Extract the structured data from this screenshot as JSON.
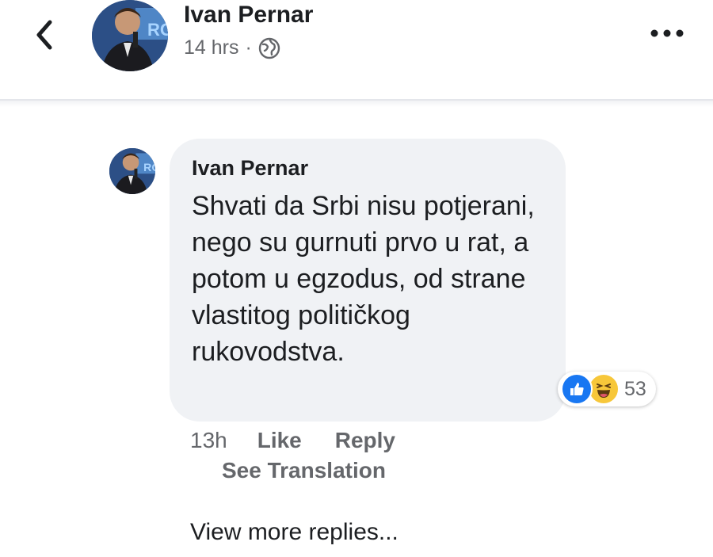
{
  "header": {
    "name": "Ivan Pernar",
    "time": "14 hrs",
    "separator": "·",
    "privacy_icon": "globe-icon",
    "back_icon": "chevron-left-icon",
    "more_icon": "more-dots-icon"
  },
  "comment": {
    "author": "Ivan Pernar",
    "text": "Shvati da Srbi nisu potjerani, nego su gurnuti prvo u rat, a potom u egzodus, od strane vlastitog političkog rukovodstva.",
    "reactions": {
      "icons": [
        "like-icon",
        "haha-icon"
      ],
      "count": "53"
    },
    "time": "13h",
    "like_label": "Like",
    "reply_label": "Reply",
    "translation_label": "See Translation"
  },
  "view_more": "View more replies...",
  "colors": {
    "accent": "#1877f2",
    "bubble": "#f0f2f5",
    "secondary_text": "#65676b"
  }
}
